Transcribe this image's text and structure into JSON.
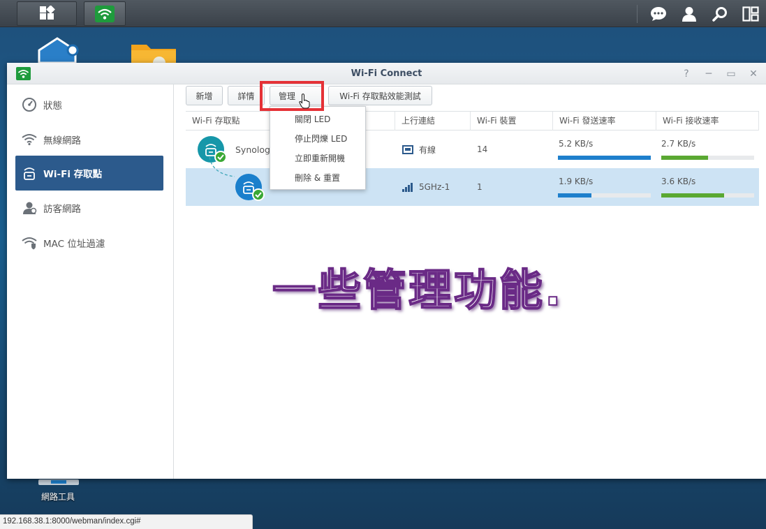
{
  "window": {
    "title": "Wi-Fi Connect"
  },
  "sidebar": {
    "items": [
      {
        "label": "狀態",
        "icon": "gauge-icon",
        "active": false
      },
      {
        "label": "無線網路",
        "icon": "wifi-icon",
        "active": false
      },
      {
        "label": "Wi-Fi 存取點",
        "icon": "router-icon",
        "active": true
      },
      {
        "label": "訪客網路",
        "icon": "guest-icon",
        "active": false
      },
      {
        "label": "MAC 位址過濾",
        "icon": "wifi-shield-icon",
        "active": false
      }
    ]
  },
  "toolbar": {
    "add_label": "新增",
    "detail_label": "詳情",
    "manage_label": "管理",
    "speedtest_label": "Wi-Fi 存取點效能測試"
  },
  "grid": {
    "columns": [
      "Wi-Fi 存取點",
      "上行連結",
      "Wi-Fi 裝置",
      "Wi-Fi 發送速率",
      "Wi-Fi 接收速率"
    ],
    "rows": [
      {
        "name": "Synolog",
        "uplink": "有線",
        "devices": "14",
        "tx": "5.2 KB/s",
        "tx_fraction": 1.0,
        "rx": "2.7 KB/s",
        "rx_fraction": 0.5
      },
      {
        "name": "",
        "uplink": "5GHz-1",
        "devices": "1",
        "tx": "1.9 KB/s",
        "tx_fraction": 0.36,
        "rx": "3.6 KB/s",
        "rx_fraction": 0.68
      }
    ]
  },
  "menu": {
    "items": [
      "關閉 LED",
      "停止閃爍 LED",
      "立即重新開機",
      "刪除 & 重置"
    ]
  },
  "desktop": {
    "network_tool_label": "網路工具"
  },
  "statusbar": {
    "url": "192.168.38.1:8000/webman/index.cgi#"
  },
  "caption": {
    "text": "一些管理功能."
  },
  "colors": {
    "accent": "#2c5a8c",
    "tx_bar": "#1e7fcc",
    "rx_bar": "#5aa832",
    "highlight": "#e53237",
    "wifi_green": "#1e9b3c"
  }
}
